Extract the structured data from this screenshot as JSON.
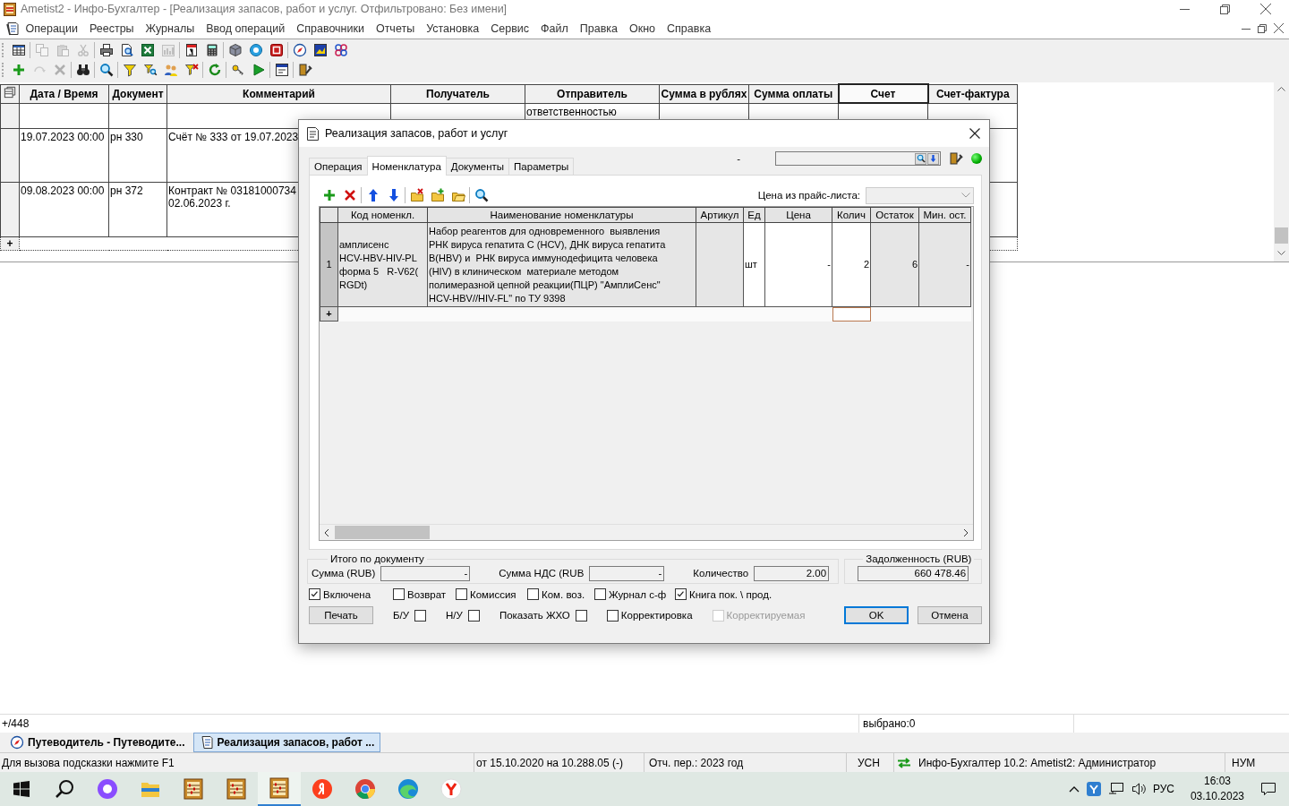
{
  "window": {
    "title": "Ametist2 - Инфо-Бухгалтер - [Реализация запасов, работ и услуг.   Отфильтровано: Без имени]"
  },
  "menu": [
    "Операции",
    "Реестры",
    "Журналы",
    "Ввод операций",
    "Справочники",
    "Отчеты",
    "Установка",
    "Сервис",
    "Файл",
    "Правка",
    "Окно",
    "Справка"
  ],
  "toolbar_1": [
    [
      {
        "disabled": false
      }
    ],
    [
      {
        "disabled": true
      },
      {
        "disabled": true
      },
      {
        "disabled": true
      }
    ],
    [
      {
        "disabled": false
      },
      {
        "disabled": false
      },
      {
        "disabled": false
      },
      {
        "disabled": true
      }
    ],
    [
      {
        "disabled": false
      },
      {
        "disabled": false
      }
    ],
    [
      {
        "disabled": false
      },
      {
        "disabled": false
      },
      {
        "disabled": false
      }
    ],
    [
      {
        "disabled": false
      },
      {
        "disabled": false
      },
      {
        "disabled": false
      }
    ]
  ],
  "toolbar_2": [
    [
      {
        "disabled": false
      },
      {
        "disabled": true
      },
      {
        "disabled": true
      }
    ],
    [
      {
        "disabled": false
      }
    ],
    [
      {
        "disabled": false
      }
    ],
    [
      {
        "disabled": false
      },
      {
        "disabled": false
      },
      {
        "disabled": false
      },
      {
        "disabled": false
      }
    ],
    [
      {
        "disabled": false
      }
    ],
    [
      {
        "disabled": false
      },
      {
        "disabled": false
      }
    ],
    [
      {
        "disabled": false
      }
    ],
    [
      {
        "disabled": false
      }
    ]
  ],
  "journal": {
    "columns": [
      {
        "label": "Дата / Время",
        "selected": false
      },
      {
        "label": "Документ",
        "selected": false
      },
      {
        "label": "Комментарий",
        "selected": false
      },
      {
        "label": "Получатель",
        "selected": false
      },
      {
        "label": "Отправитель",
        "selected": false
      },
      {
        "label": "Сумма в рублях",
        "selected": false
      },
      {
        "label": "Сумма оплаты",
        "selected": false
      },
      {
        "label": "Счет",
        "selected": true
      },
      {
        "label": "Счет-фактура",
        "selected": false
      }
    ],
    "rows": [
      {
        "cells": [
          "",
          "",
          "",
          "",
          "ответственностью",
          "",
          "",
          "",
          ""
        ]
      },
      {
        "cells": [
          "19.07.2023 00:00",
          "рн 330",
          "Счёт № 333 от 19.07.2023",
          "",
          "",
          "",
          "",
          "",
          ""
        ]
      },
      {
        "cells": [
          "09.08.2023 00:00",
          "рн 372",
          "Контракт № 03181000734\n02.06.2023 г.",
          "",
          "",
          "",
          "",
          "",
          ""
        ]
      }
    ],
    "new_row_marker": "+"
  },
  "record_count": "+/448",
  "selected_count": "выбрано:0",
  "document_tabs": [
    {
      "label": "Путеводитель - Путеводите...",
      "selected": false
    },
    {
      "label": "Реализация запасов, работ ...",
      "selected": true
    }
  ],
  "status_bar": {
    "hint": "Для вызова подсказки нажмите F1",
    "version_date": "от 15.10.2020 на 10.288.05 (-)",
    "period": "Отч. пер.: 2023 год",
    "tax": "УСН",
    "user": "Инфо-Бухгалтер 10.2: Ametist2: Администратор",
    "keyboard": "НУМ"
  },
  "taskbar": {
    "apps": [
      {
        "selected": false
      },
      {
        "selected": false
      },
      {
        "selected": false
      },
      {
        "selected": false
      },
      {
        "selected": true
      },
      {
        "selected": false
      },
      {
        "selected": false
      },
      {
        "selected": false
      },
      {
        "selected": false
      }
    ],
    "language": "РУС",
    "time": "16:03",
    "date": "03.10.2023"
  },
  "dialog": {
    "title": "Реализация запасов, работ и услуг",
    "tabs": [
      {
        "label": "Операция",
        "selected": false
      },
      {
        "label": "Номенклатура",
        "selected": true
      },
      {
        "label": "Документы",
        "selected": false
      },
      {
        "label": "Параметры",
        "selected": false
      }
    ],
    "search_note": "-",
    "price_list": {
      "label": "Цена из прайс-листа:",
      "disabled": true
    },
    "grid": {
      "columns": [
        {
          "label": "Код номенкл.",
          "editable": false,
          "new_row_focused": false
        },
        {
          "label": "Наименование номенклатуры",
          "editable": false,
          "new_row_focused": false
        },
        {
          "label": "Артикул",
          "editable": false,
          "new_row_focused": false
        },
        {
          "label": "Ед",
          "editable": true,
          "new_row_focused": false
        },
        {
          "label": "Цена",
          "editable": true,
          "new_row_focused": false
        },
        {
          "label": "Колич",
          "editable": true,
          "new_row_focused": true
        },
        {
          "label": "Остаток",
          "editable": false,
          "new_row_focused": false
        },
        {
          "label": "Мин. ост.",
          "editable": false,
          "new_row_focused": false
        }
      ],
      "rows": [
        {
          "number": "1",
          "cells": [
            "амплисенс\nHCV-HBV-HIV-PL\nформа 5   R-V62(\nRGDt)",
            "Набор реагентов для одновременного  выявления\nРНК вируса гепатита С (HCV), ДНК вируса гепатита\nВ(HBV) и  РНК вируса иммунодефицита человека\n(HIV) в клиническом  материале методом\nполимеразной цепной реакции(ПЦР) \"АмплиСенс\"\nHCV-HBV//HIV-FL\" по ТУ 9398",
            "",
            "шт",
            "-",
            "2",
            "6",
            "-"
          ]
        }
      ],
      "new_row_marker": "+"
    },
    "totals": {
      "title": "Итого по документу",
      "fields": [
        {
          "label": "Сумма (RUB)",
          "value": "-"
        },
        {
          "label": "Сумма НДС (RUB",
          "value": "-"
        },
        {
          "label": "Количество",
          "value": "2.00"
        }
      ]
    },
    "debt": {
      "title": "Задолженность (RUB)",
      "value": "660 478.46"
    },
    "flags": [
      {
        "label": "Включена",
        "checked": true
      },
      {
        "label": "Возврат",
        "checked": false
      },
      {
        "label": "Комиссия",
        "checked": false
      },
      {
        "label": "Ком. воз.",
        "checked": false
      },
      {
        "label": "Журнал с-ф",
        "checked": false
      },
      {
        "label": "Книга пок. \\ прод.",
        "checked": true
      }
    ],
    "print_button": "Печать",
    "options": [
      {
        "label": "Б/У",
        "kind": "label_first",
        "checked": false,
        "disabled": false
      },
      {
        "label": "Н/У",
        "kind": "label_first",
        "checked": false,
        "disabled": false
      },
      {
        "label": "Показать ЖХО",
        "kind": "label_first",
        "checked": false,
        "disabled": false
      },
      {
        "label": "Корректировка",
        "kind": "box_first",
        "checked": false,
        "disabled": false
      },
      {
        "label": "Корректируемая",
        "kind": "box_first",
        "checked": false,
        "disabled": true
      }
    ],
    "buttons": [
      {
        "label": "OK",
        "default": true
      },
      {
        "label": "Отмена",
        "default": false
      }
    ]
  }
}
